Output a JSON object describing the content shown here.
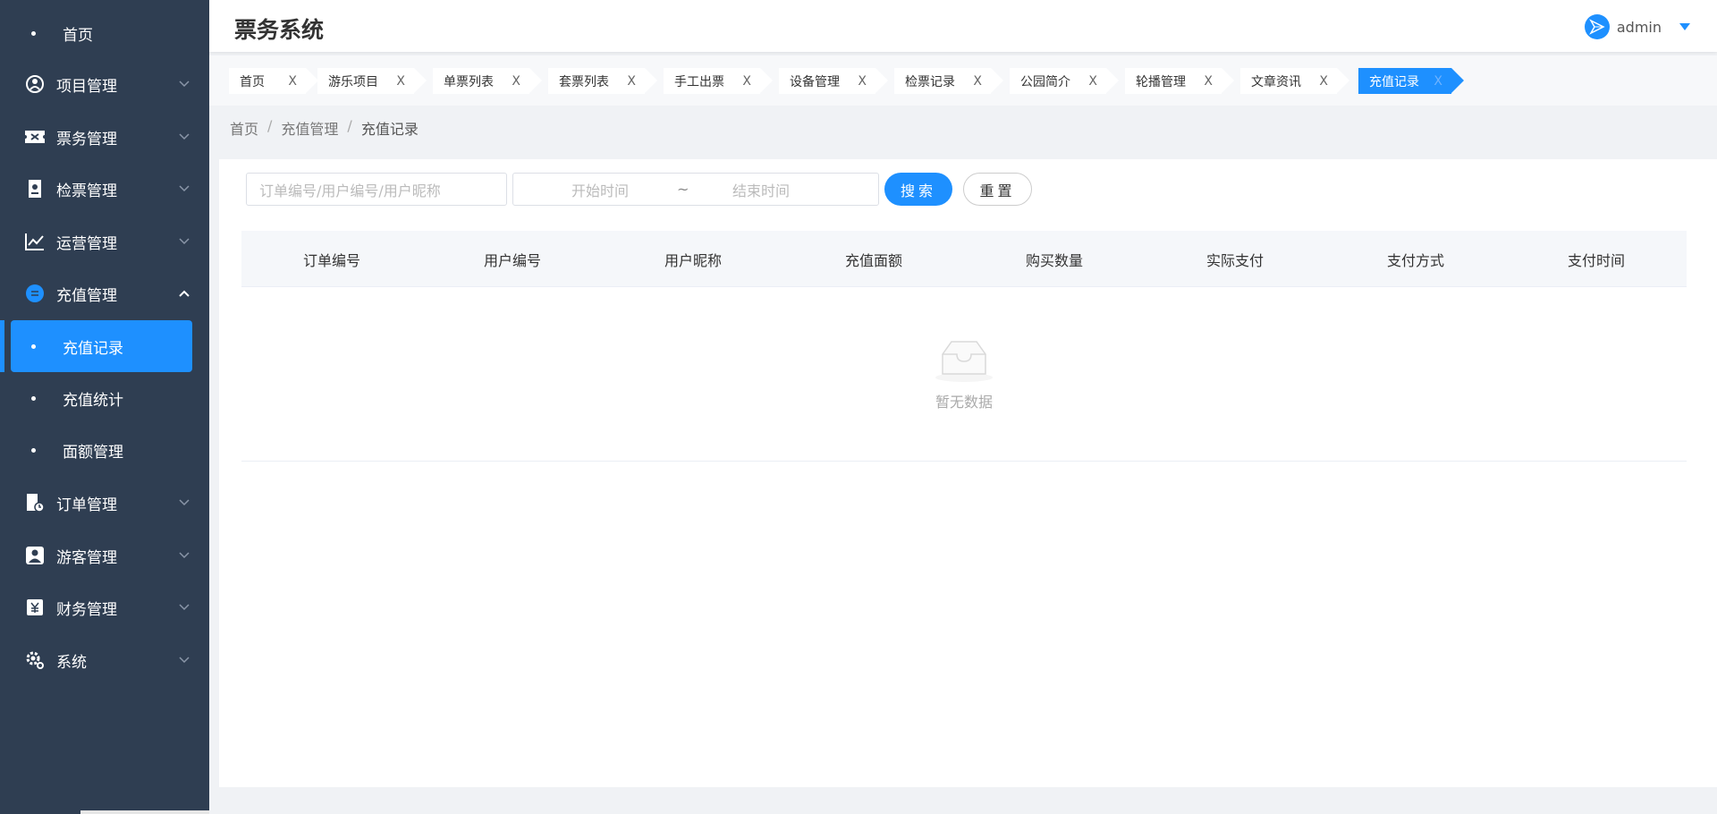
{
  "header": {
    "title": "票务系统",
    "user": "admin"
  },
  "sidebar": {
    "items": [
      {
        "label": "首页",
        "icon": "home-dot"
      },
      {
        "label": "项目管理",
        "icon": "project-icon"
      },
      {
        "label": "票务管理",
        "icon": "ticket-icon"
      },
      {
        "label": "检票管理",
        "icon": "check-ticket-icon"
      },
      {
        "label": "运营管理",
        "icon": "chart-icon"
      },
      {
        "label": "充值管理",
        "icon": "recharge-icon",
        "expanded": true
      },
      {
        "label": "订单管理",
        "icon": "order-icon"
      },
      {
        "label": "游客管理",
        "icon": "visitor-icon"
      },
      {
        "label": "财务管理",
        "icon": "finance-icon"
      },
      {
        "label": "系统",
        "icon": "gear-icon"
      }
    ],
    "recharge_sub": [
      {
        "label": "充值记录",
        "active": true
      },
      {
        "label": "充值统计"
      },
      {
        "label": "面额管理"
      }
    ]
  },
  "tags": [
    {
      "label": "首页",
      "close": "X"
    },
    {
      "label": "游乐项目",
      "close": "X"
    },
    {
      "label": "单票列表",
      "close": "X"
    },
    {
      "label": "套票列表",
      "close": "X"
    },
    {
      "label": "手工出票",
      "close": "X"
    },
    {
      "label": "设备管理",
      "close": "X"
    },
    {
      "label": "检票记录",
      "close": "X"
    },
    {
      "label": "公园简介",
      "close": "X"
    },
    {
      "label": "轮播管理",
      "close": "X"
    },
    {
      "label": "文章资讯",
      "close": "X"
    },
    {
      "label": "充值记录",
      "close": "X",
      "active": true
    }
  ],
  "breadcrumb": {
    "items": [
      "首页",
      "充值管理",
      "充值记录"
    ],
    "separator": "/"
  },
  "search": {
    "placeholder": "订单编号/用户编号/用户昵称",
    "start_placeholder": "开始时间",
    "range_separator": "~",
    "end_placeholder": "结束时间",
    "search_label": "搜索",
    "reset_label": "重置"
  },
  "table": {
    "columns": [
      "订单编号",
      "用户编号",
      "用户昵称",
      "充值面额",
      "购买数量",
      "实际支付",
      "支付方式",
      "支付时间"
    ],
    "rows": [],
    "empty_text": "暂无数据"
  },
  "colors": {
    "sidebar_bg": "#2f3e52",
    "accent": "#1e90ff"
  }
}
